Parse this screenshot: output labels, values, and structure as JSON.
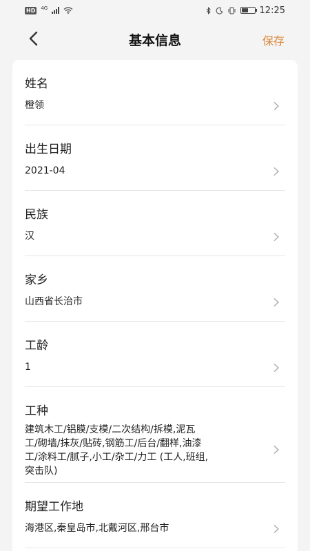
{
  "status_bar": {
    "hd": "HD",
    "network": "4G",
    "time": "12:25"
  },
  "navbar": {
    "title": "基本信息",
    "save_label": "保存"
  },
  "fields": [
    {
      "label": "姓名",
      "value": "橙领"
    },
    {
      "label": "出生日期",
      "value": "2021-04"
    },
    {
      "label": "民族",
      "value": "汉"
    },
    {
      "label": "家乡",
      "value": "山西省长治市"
    },
    {
      "label": "工龄",
      "value": "1"
    },
    {
      "label": "工种",
      "value_lines": [
        "建筑木工/铝膜/支模/二次结构/拆模,泥瓦",
        "工/砌墙/抹灰/贴砖,钢筋工/后台/翻样,油漆",
        "工/涂料工/腻子,小工/杂工/力工 (工人,班组,",
        "突击队)"
      ]
    },
    {
      "label": "期望工作地",
      "value": "海港区,秦皇岛市,北戴河区,邢台市"
    }
  ],
  "colors": {
    "accent": "#d8883a",
    "background": "#f4f4f4",
    "divider": "#e6e6e6"
  },
  "icons": {
    "back": "chevron-left-icon",
    "row_arrow": "chevron-right-icon"
  }
}
